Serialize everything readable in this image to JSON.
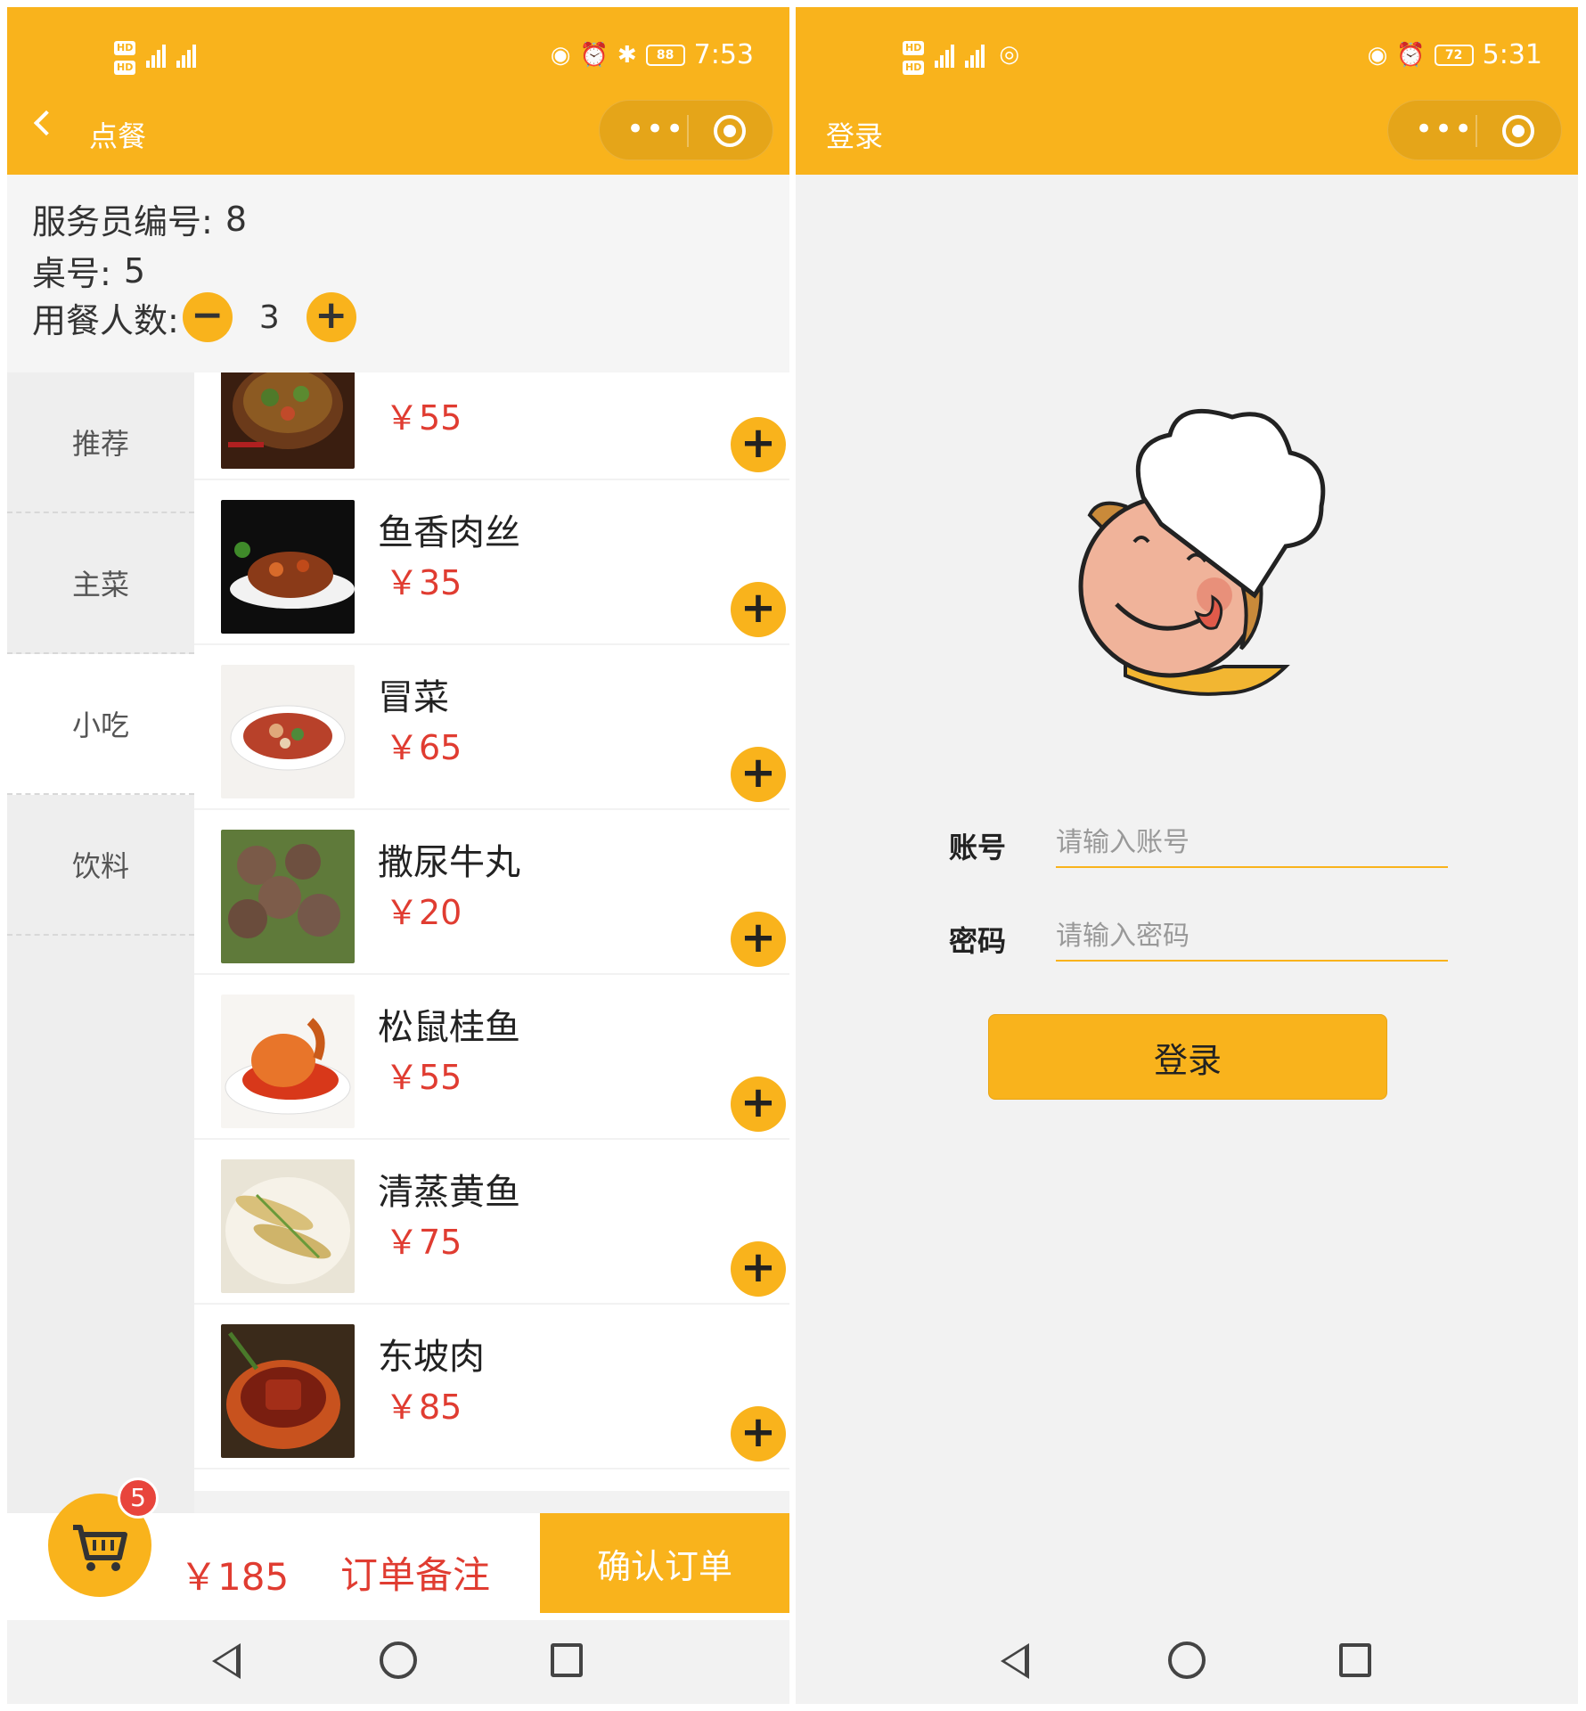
{
  "order_screen": {
    "status_bar": {
      "sim": [
        "HD",
        "HD"
      ],
      "network": [
        "4G",
        "4G"
      ],
      "icons": [
        "eye-icon",
        "alarm-icon",
        "bluetooth-icon"
      ],
      "battery": "88",
      "time": "7:53"
    },
    "nav": {
      "title": "点餐",
      "menu_dots": "•••"
    },
    "info": {
      "waiter_label": "服务员编号:",
      "waiter_value": "8",
      "table_label": "桌号:",
      "table_value": "5",
      "diners_label": "用餐人数:",
      "diners_value": "3",
      "minus": "−",
      "plus": "+"
    },
    "categories": [
      {
        "label": "推荐"
      },
      {
        "label": "主菜"
      },
      {
        "label": "小吃"
      },
      {
        "label": "饮料"
      }
    ],
    "active_category": "小吃",
    "dishes": [
      {
        "name": "",
        "price": "￥55",
        "plus": "+"
      },
      {
        "name": "鱼香肉丝",
        "price": "￥35",
        "plus": "+"
      },
      {
        "name": "冒菜",
        "price": "￥65",
        "plus": "+"
      },
      {
        "name": "撒尿牛丸",
        "price": "￥20",
        "plus": "+"
      },
      {
        "name": "松鼠桂鱼",
        "price": "￥55",
        "plus": "+"
      },
      {
        "name": "清蒸黄鱼",
        "price": "￥75",
        "plus": "+"
      },
      {
        "name": "东坡肉",
        "price": "￥85",
        "plus": "+"
      }
    ],
    "bottom": {
      "cart_count": "5",
      "total": "￥185",
      "remark": "订单备注",
      "confirm": "确认订单"
    }
  },
  "login_screen": {
    "status_bar": {
      "sim": [
        "HD",
        "HD"
      ],
      "network": [
        "4G",
        "4G"
      ],
      "icons": [
        "eye-icon",
        "alarm-icon",
        "hotspot-icon"
      ],
      "battery": "72",
      "time": "5:31"
    },
    "nav": {
      "title": "登录",
      "menu_dots": "•••"
    },
    "form": {
      "account_label": "账号",
      "account_placeholder": "请输入账号",
      "password_label": "密码",
      "password_placeholder": "请输入密码",
      "submit": "登录"
    }
  },
  "colors": {
    "brand": "#f9b31c",
    "price": "#e03c31",
    "badge": "#e8453c",
    "background": "#f2f2f2"
  }
}
